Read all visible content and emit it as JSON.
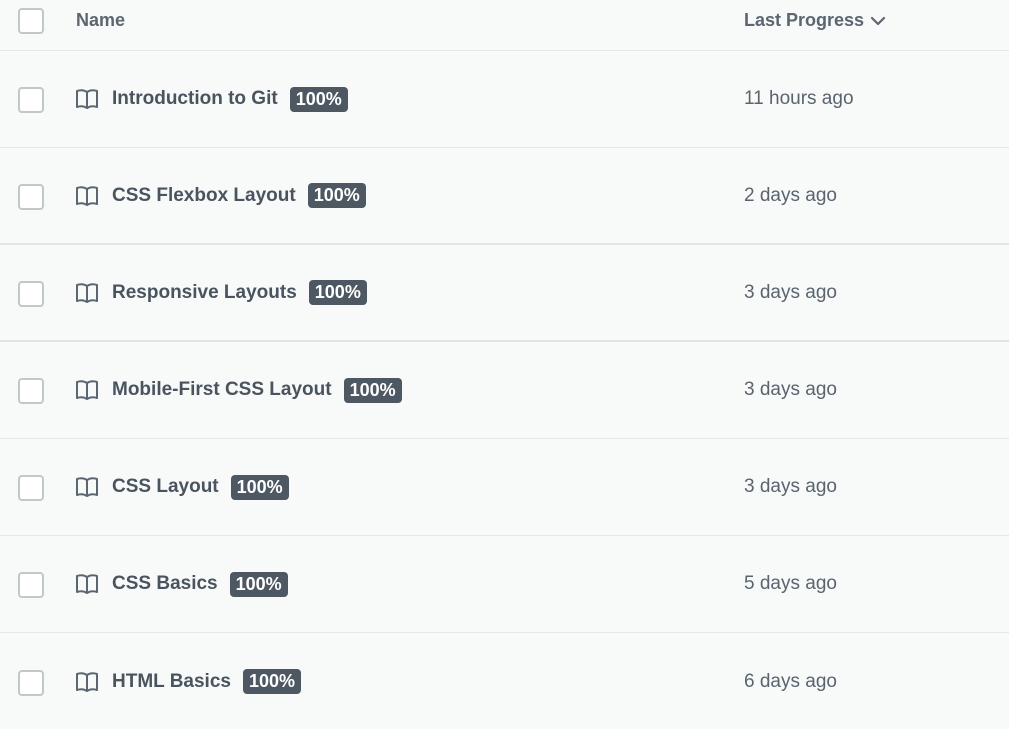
{
  "header": {
    "name_label": "Name",
    "progress_label": "Last Progress"
  },
  "rows": [
    {
      "title": "Introduction to Git",
      "progress": "100%",
      "last_progress": "11 hours ago"
    },
    {
      "title": "CSS Flexbox Layout",
      "progress": "100%",
      "last_progress": "2 days ago"
    },
    {
      "title": "Responsive Layouts",
      "progress": "100%",
      "last_progress": "3 days ago"
    },
    {
      "title": "Mobile-First CSS Layout",
      "progress": "100%",
      "last_progress": "3 days ago"
    },
    {
      "title": "CSS Layout",
      "progress": "100%",
      "last_progress": "3 days ago"
    },
    {
      "title": "CSS Basics",
      "progress": "100%",
      "last_progress": "5 days ago"
    },
    {
      "title": "HTML Basics",
      "progress": "100%",
      "last_progress": "6 days ago"
    }
  ],
  "icons": {
    "row_icon": "book-open-icon",
    "sort_icon": "chevron-down-icon"
  },
  "colors": {
    "badge_bg": "#4d5862",
    "background": "#f8f9f9"
  }
}
